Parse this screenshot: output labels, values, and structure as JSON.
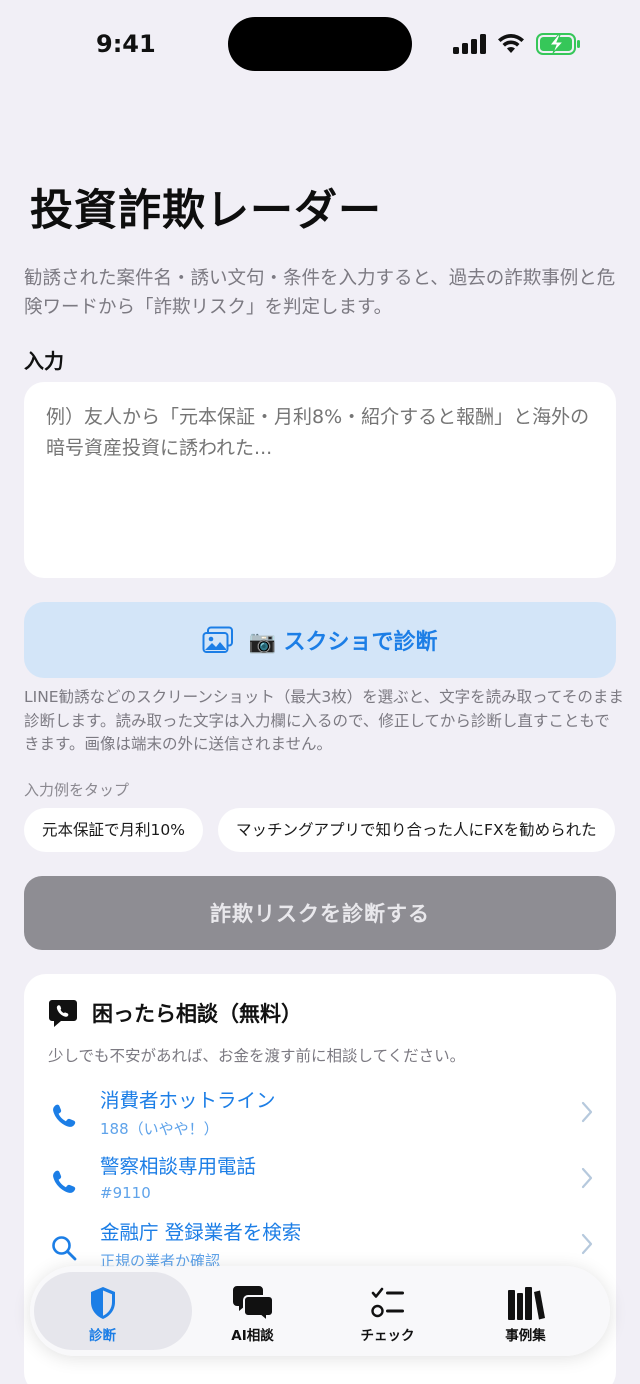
{
  "status_bar": {
    "time": "9:41"
  },
  "title": "投資詐欺レーダー",
  "description": "勧誘された案件名・誘い文句・条件を入力すると、過去の詐欺事例と危険ワードから「詐欺リスク」を判定します。",
  "input_section": {
    "label": "入力",
    "placeholder": "例）友人から「元本保証・月利8%・紹介すると報酬」と海外の暗号資産投資に誘われた..."
  },
  "screenshot_button": {
    "label": "📷 スクショで診断",
    "icon": "photo-icon"
  },
  "screenshot_note": "LINE勧誘などのスクリーンショット（最大3枚）を選ぶと、文字を読み取ってそのまま診断します。読み取った文字は入力欄に入るので、修正してから診断し直すこともできます。画像は端末の外に送信されません。",
  "examples": {
    "label": "入力例をタップ",
    "chips": [
      "元本保証で月利10%",
      "マッチングアプリで知り合った人にFXを勧められた"
    ]
  },
  "diagnose_button": {
    "label": "詐欺リスクを診断する"
  },
  "consult_card": {
    "title": "困ったら相談（無料）",
    "subtitle": "少しでも不安があれば、お金を渡す前に相談してください。",
    "items": [
      {
        "title": "消費者ホットライン",
        "subtitle": "188（いやや！）",
        "icon": "phone-icon"
      },
      {
        "title": "警察相談専用電話",
        "subtitle": "#9110",
        "icon": "phone-icon"
      },
      {
        "title": "金融庁 登録業者を検索",
        "subtitle": "正規の業者か確認",
        "icon": "search-icon"
      }
    ]
  },
  "tab_bar": {
    "tabs": [
      {
        "label": "診断",
        "icon": "shield-icon",
        "active": true
      },
      {
        "label": "AI相談",
        "icon": "chat-bubbles-icon",
        "active": false
      },
      {
        "label": "チェック",
        "icon": "checklist-icon",
        "active": false
      },
      {
        "label": "事例集",
        "icon": "books-icon",
        "active": false
      }
    ]
  },
  "colors": {
    "accent": "#1C7EE6",
    "background": "#F1EFF6",
    "disabled_button": "#8E8D93"
  }
}
